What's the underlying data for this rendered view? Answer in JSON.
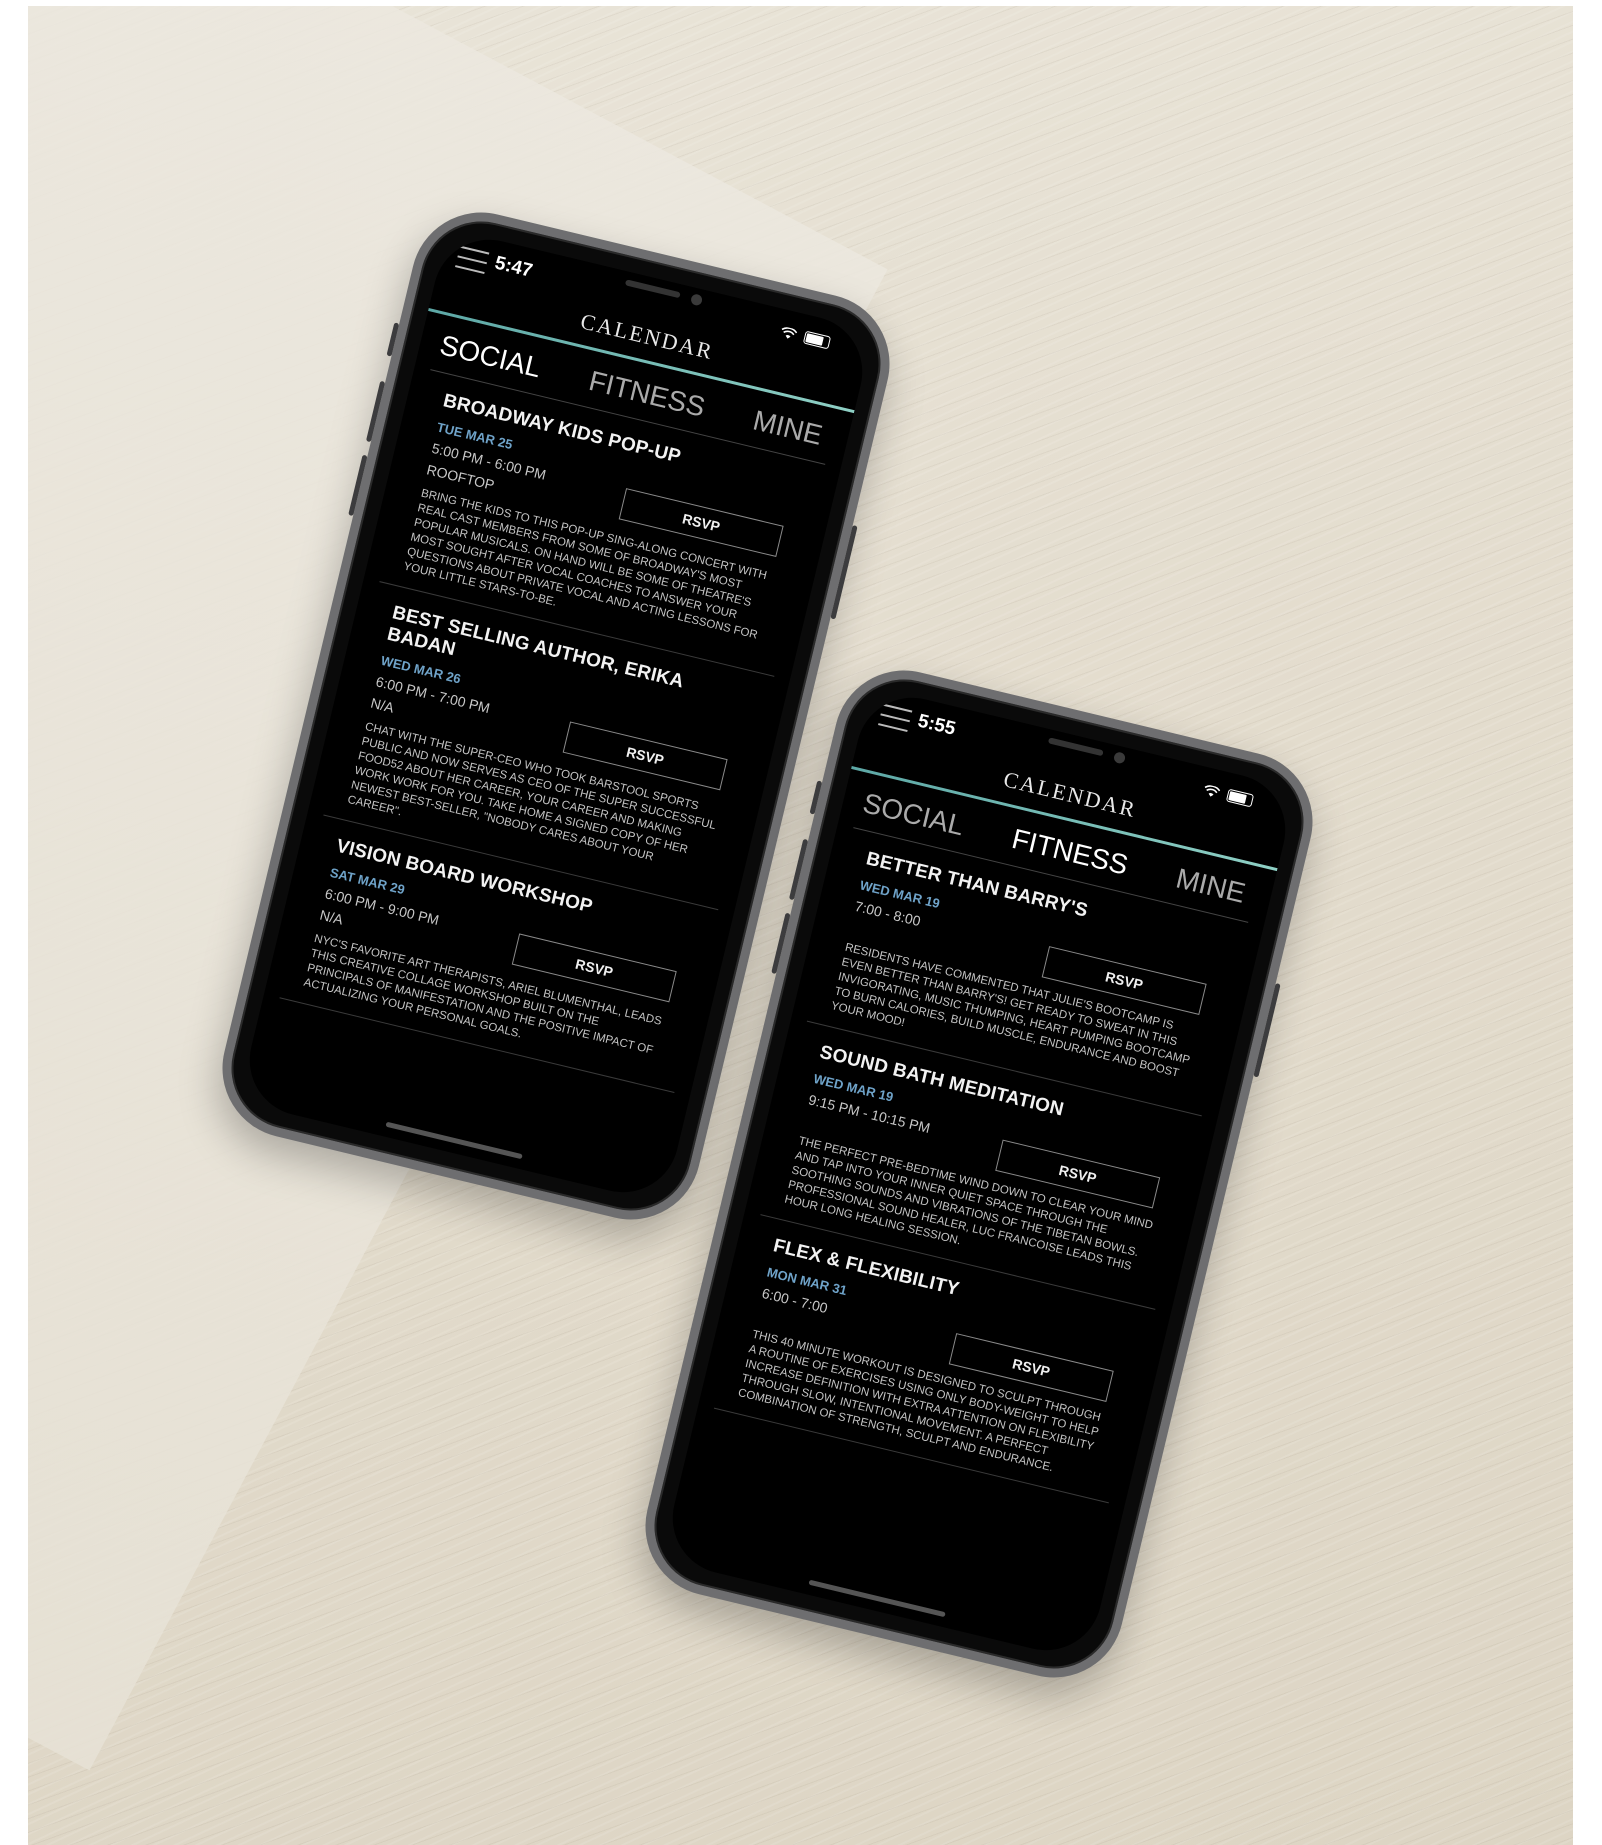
{
  "left_phone": {
    "time": "5:47",
    "title": "CALENDAR",
    "tabs": [
      "SOCIAL",
      "FITNESS",
      "MINE"
    ],
    "active_tab": "SOCIAL",
    "events": [
      {
        "title": "BROADWAY KIDS POP-UP",
        "date": "TUE MAR 25",
        "time": "5:00 PM - 6:00 PM",
        "location": "ROOFTOP",
        "rsvp": "RSVP",
        "description": "BRING THE KIDS TO THIS POP-UP SING-ALONG CONCERT WITH REAL CAST MEMBERS FROM SOME OF BROADWAY'S MOST POPULAR MUSICALS. ON HAND WILL BE SOME OF THEATRE'S MOST SOUGHT AFTER VOCAL COACHES TO ANSWER YOUR QUESTIONS ABOUT PRIVATE VOCAL AND ACTING LESSONS FOR YOUR LITTLE STARS-TO-BE."
      },
      {
        "title": "BEST SELLING AUTHOR, ERIKA BADAN",
        "date": "WED MAR 26",
        "time": "6:00 PM - 7:00 PM",
        "location": "N/A",
        "rsvp": "RSVP",
        "description": "CHAT WITH THE SUPER-CEO WHO TOOK BARSTOOL SPORTS PUBLIC AND NOW SERVES AS CEO OF THE SUPER SUCCESSFUL FOOD52 ABOUT HER CAREER, YOUR CAREER AND MAKING WORK WORK FOR YOU. TAKE HOME A SIGNED COPY OF HER NEWEST BEST-SELLER, \"NOBODY CARES ABOUT YOUR CAREER\"."
      },
      {
        "title": "VISION BOARD WORKSHOP",
        "date": "SAT MAR 29",
        "time": "6:00 PM - 9:00 PM",
        "location": "N/A",
        "rsvp": "RSVP",
        "description": "NYC'S FAVORITE ART THERAPISTS, ARIEL BLUMENTHAL, LEADS THIS CREATIVE COLLAGE WORKSHOP BUILT ON THE PRINCIPALS OF MANIFESTATION AND THE POSITIVE IMPACT OF ACTUALIZING YOUR PERSONAL GOALS."
      }
    ]
  },
  "right_phone": {
    "time": "5:55",
    "title": "CALENDAR",
    "tabs": [
      "SOCIAL",
      "FITNESS",
      "MINE"
    ],
    "active_tab": "FITNESS",
    "events": [
      {
        "title": "BETTER THAN BARRY'S",
        "date": "WED MAR 19",
        "time": "7:00 - 8:00",
        "rsvp": "RSVP",
        "description": "RESIDENTS HAVE COMMENTED THAT JULIE'S BOOTCAMP IS EVEN BETTER THAN BARRY'S! GET READY TO SWEAT IN THIS INVIGORATING, MUSIC THUMPING, HEART PUMPING BOOTCAMP TO BURN CALORIES, BUILD MUSCLE, ENDURANCE AND BOOST YOUR MOOD!"
      },
      {
        "title": "SOUND BATH MEDITATION",
        "date": "WED MAR 19",
        "time": "9:15 PM - 10:15 PM",
        "rsvp": "RSVP",
        "description": "THE PERFECT PRE-BEDTIME WIND DOWN TO CLEAR YOUR MIND AND TAP INTO YOUR INNER QUIET SPACE THROUGH THE SOOTHING SOUNDS AND VIBRATIONS OF THE TIBETAN BOWLS. PROFESSIONAL SOUND HEALER, LUC FRANCOISE LEADS THIS HOUR LONG HEALING SESSION."
      },
      {
        "title": "FLEX & FLEXIBILITY",
        "date": "MON MAR 31",
        "time": "6:00 - 7:00",
        "rsvp": "RSVP",
        "description": "THIS 40 MINUTE WORKOUT IS DESIGNED TO SCULPT THROUGH A ROUTINE OF EXERCISES USING ONLY BODY-WEIGHT TO HELP INCREASE DEFINITION WITH EXTRA ATTENTION ON FLEXIBILITY THROUGH SLOW, INTENTIONAL MOVEMENT. A PERFECT COMBINATION OF STRENGTH, SCULPT AND ENDURANCE."
      }
    ]
  },
  "colors": {
    "screen_bg": "#000000",
    "accent_rule": "#7cc7bd",
    "date_text": "#6fa3c9",
    "backdrop": "#e3dccd"
  }
}
